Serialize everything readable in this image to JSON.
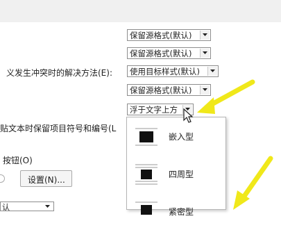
{
  "settings": {
    "rows": [
      {
        "label": "",
        "value": "保留源格式(默认)"
      },
      {
        "label": "",
        "value": "保留源格式(默认)"
      },
      {
        "label": "义发生冲突时的解决方法(E):",
        "value": "使用目标样式(默认)"
      },
      {
        "label": "",
        "value": "保留源格式(默认)"
      },
      {
        "label": "",
        "value": "浮于文字上方"
      }
    ],
    "bullets_label": "贴文本时保留项目符号和编号(L",
    "button_group_label": "按钮(O)",
    "settings_button": "设置(N)...",
    "bottom_select_value": "认"
  },
  "wrap_menu": {
    "options": [
      {
        "label": "嵌入型",
        "icon": "inline-wrap-icon"
      },
      {
        "label": "四周型",
        "icon": "square-wrap-icon"
      },
      {
        "label": "紧密型",
        "icon": "tight-wrap-icon"
      }
    ]
  },
  "colors": {
    "annotation_arrow": "#f0e81a"
  }
}
